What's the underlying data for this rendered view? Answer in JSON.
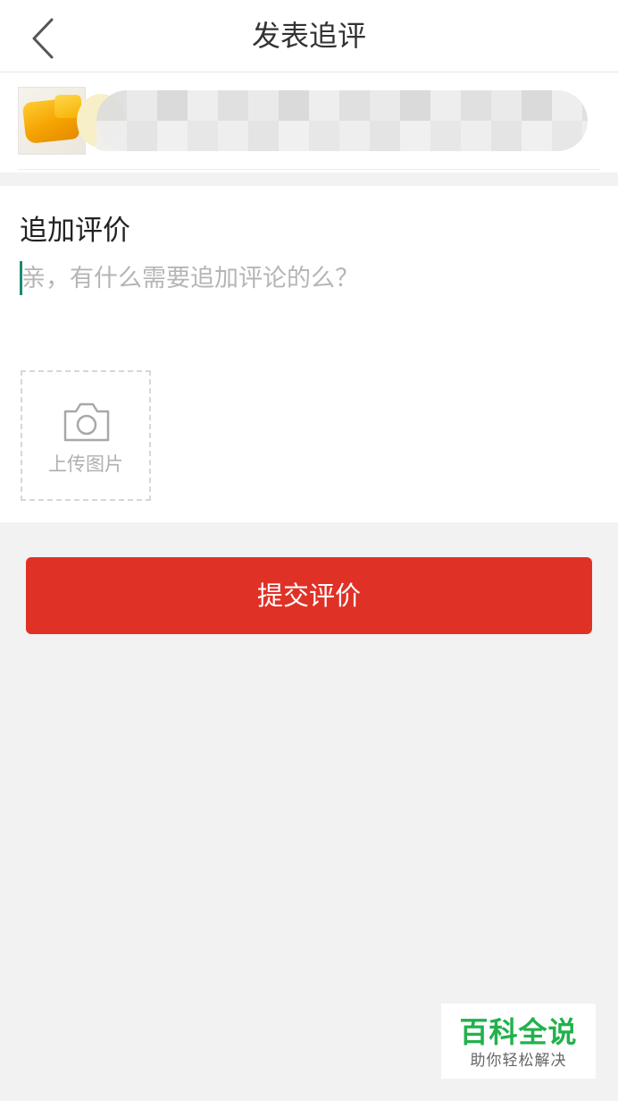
{
  "header": {
    "title": "发表追评",
    "back_icon": "chevron-left-icon"
  },
  "product": {
    "thumbnail_icon": "product-thumbnail",
    "title_obscured": true
  },
  "review": {
    "section_title": "追加评价",
    "input_value": "",
    "input_placeholder": "亲，有什么需要追加评论的么？",
    "upload_label": "上传图片",
    "upload_icon": "camera-icon"
  },
  "actions": {
    "submit_label": "提交评价"
  },
  "watermark": {
    "title": "百科全说",
    "subtitle": "助你轻松解决"
  },
  "colors": {
    "accent": "#e03126",
    "caret": "#1a8a73",
    "watermark": "#22b14c",
    "background": "#f2f2f2"
  }
}
